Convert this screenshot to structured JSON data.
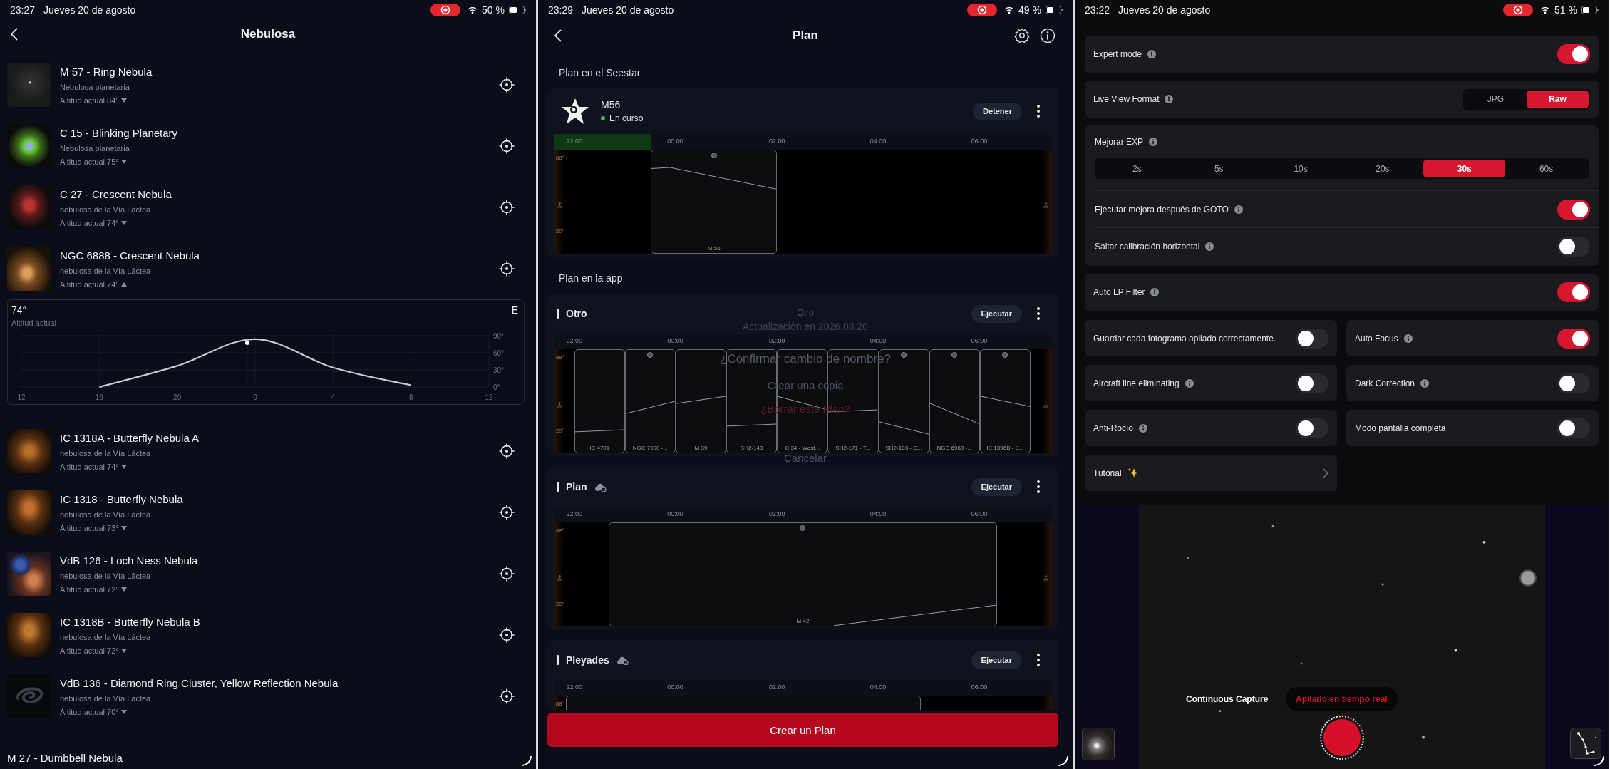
{
  "left": {
    "status_bar": {
      "time": "23:27",
      "date": "Jueves 20 de agosto",
      "battery": "50 %"
    },
    "title": "Nebulosa",
    "objects": [
      {
        "name": "M 57 - Ring Nebula",
        "type": "Nebulosa planetaria",
        "altitude": "Altitud actual 84°",
        "expanded": false,
        "kind": "photo"
      },
      {
        "name": "C 15 - Blinking Planetary",
        "type": "Nebulosa planetaria",
        "altitude": "Altitud actual 75°",
        "expanded": false,
        "kind": "photo"
      },
      {
        "name": "C 27 - Crescent Nebula",
        "type": "nebulosa de la Vía Láctea",
        "altitude": "Altitud actual 74°",
        "expanded": false,
        "kind": "photo"
      },
      {
        "name": "NGC 6888 - Crescent Nebula",
        "type": "nebulosa de la Vía Láctea",
        "altitude": "Altitud actual 74°",
        "expanded": true,
        "kind": "photo",
        "detail": {
          "altitude": "74°",
          "caption": "Altitud actual",
          "direction": "E",
          "chart_data": {
            "type": "line",
            "categories": [
              "12",
              "16",
              "20",
              "0",
              "4",
              "8",
              "12"
            ],
            "values": [
              null,
              0,
              37,
              84,
              34,
              3,
              null
            ],
            "ylim": [
              0,
              90
            ],
            "yticks": [
              {
                "value": 0,
                "label": "0°"
              },
              {
                "value": 30,
                "label": "30°"
              },
              {
                "value": 60,
                "label": "60°"
              },
              {
                "value": 90,
                "label": "90°"
              }
            ],
            "grid": true
          }
        }
      },
      {
        "name": "IC 1318A - Butterfly Nebula A",
        "type": "nebulosa de la Vía Láctea",
        "altitude": "Altitud actual 74°",
        "expanded": false,
        "kind": "photo"
      },
      {
        "name": "IC 1318 - Butterfly Nebula",
        "type": "nebulosa de la Vía Láctea",
        "altitude": "Altitud actual 73°",
        "expanded": false,
        "kind": "photo"
      },
      {
        "name": "VdB 126 - Loch Ness Nebula",
        "type": "nebulosa de la Vía Láctea",
        "altitude": "Altitud actual 72°",
        "expanded": false,
        "kind": "photo"
      },
      {
        "name": "IC 1318B - Butterfly Nebula B",
        "type": "nebulosa de la Vía Láctea",
        "altitude": "Altitud actual 72°",
        "expanded": false,
        "kind": "photo"
      },
      {
        "name": "VdB 136 - Diamond Ring Cluster, Yellow Reflection Nebula",
        "type": "nebulosa de la Vía Láctea",
        "altitude": "Altitud actual 70°",
        "expanded": false,
        "kind": "icon"
      },
      {
        "name": "M 27 - Dumbbell Nebula"
      }
    ]
  },
  "middle": {
    "status_bar": {
      "time": "23:29",
      "date": "Jueves 20 de agosto",
      "battery": "49 %"
    },
    "title": "Plan",
    "seestar_title": "Plan en el Seestar",
    "seestar_plan": {
      "target": "M56",
      "status": "En curso",
      "button": "Detener",
      "chart": {
        "times": [
          "22:00",
          "00:00",
          "02:00",
          "04:00",
          "06:00"
        ],
        "altitudes": [
          "88°",
          "20°"
        ],
        "blocks": [
          {
            "label": "M 56",
            "marker": true
          }
        ]
      }
    },
    "app_title": "Plan en la app",
    "app_plans": [
      {
        "name": "Otro",
        "cloud": false,
        "button": "Ejecutar",
        "chart": {
          "times": [
            "22:00",
            "00:00",
            "02:00",
            "04:00",
            "06:00"
          ],
          "altitudes": [
            "88°",
            "20°"
          ],
          "blocks": [
            {
              "label": "IC 4701",
              "marker": false
            },
            {
              "label": "NGC 7000 -...",
              "marker": true
            },
            {
              "label": "M 39",
              "marker": false
            },
            {
              "label": "SH2-140",
              "marker": false
            },
            {
              "label": "C 34 - West...",
              "marker": false
            },
            {
              "label": "SH2-171 - T...",
              "marker": false
            },
            {
              "label": "SH2-103 - C...",
              "marker": true
            },
            {
              "label": "NGC 6960 -...",
              "marker": true
            },
            {
              "label": "IC 1396B - E...",
              "marker": true
            }
          ]
        }
      },
      {
        "name": "Plan",
        "cloud": true,
        "button": "Ejecutar",
        "chart": {
          "times": [
            "22:00",
            "00:00",
            "02:00",
            "04:00",
            "06:00"
          ],
          "altitudes": [
            "88°",
            "20°"
          ],
          "blocks": [
            {
              "label": "M 42",
              "marker": true
            }
          ]
        }
      },
      {
        "name": "Pleyades",
        "cloud": true,
        "button": "Ejecutar",
        "chart": {
          "times": [
            "22:00",
            "00:00",
            "02:00",
            "04:00",
            "06:00"
          ],
          "altitudes": [
            "88°"
          ],
          "blocks": [
            {
              "marker": false
            }
          ]
        }
      }
    ],
    "dialog": {
      "title": "Otro",
      "subtitle": "Actualización en 2026.08.20",
      "items": [
        {
          "label": "¿Confirmar cambio de nombre?",
          "kind": "prompt"
        },
        {
          "label": "Crear una copia",
          "kind": "action"
        },
        {
          "label": "¿Borrar este Plan?",
          "kind": "destructive"
        },
        {
          "label": "Cancelar",
          "kind": "action"
        }
      ]
    },
    "create_button": "Crear un Plan"
  },
  "right": {
    "status_bar": {
      "time": "23:22",
      "date": "Jueves 20 de agosto",
      "battery": "51 %"
    },
    "settings": [
      {
        "kind": "toggle",
        "label": "Expert mode",
        "info": true,
        "on": true
      },
      {
        "kind": "segmented",
        "label": "Live View Format",
        "info": true,
        "options": [
          {
            "label": "JPG",
            "selected": false
          },
          {
            "label": "Raw",
            "selected": true
          }
        ]
      },
      {
        "kind": "group",
        "label": "Mejorar EXP",
        "info": true,
        "options": [
          {
            "label": "2s",
            "selected": false
          },
          {
            "label": "5s",
            "selected": false
          },
          {
            "label": "10s",
            "selected": false
          },
          {
            "label": "20s",
            "selected": false
          },
          {
            "label": "30s",
            "selected": true
          },
          {
            "label": "60s",
            "selected": false
          }
        ],
        "rows": [
          {
            "label": "Ejecutar mejora después de GOTO",
            "info": true,
            "on": true
          },
          {
            "label": "Saltar calibración horizontal",
            "info": true,
            "on": false
          }
        ]
      },
      {
        "kind": "toggle",
        "label": "Auto LP Filter",
        "info": true,
        "on": true
      }
    ],
    "grid": [
      {
        "kind": "toggle",
        "label": "Guardar cada fotograma apilado correctamente.",
        "info": false,
        "on": false
      },
      {
        "kind": "toggle",
        "label": "Auto Focus",
        "info": true,
        "on": true
      },
      {
        "kind": "toggle",
        "label": "Aircraft line eliminating",
        "info": true,
        "on": false
      },
      {
        "kind": "toggle",
        "label": "Dark Correction",
        "info": true,
        "on": false
      },
      {
        "kind": "toggle",
        "label": "Anti-Rocío",
        "info": true,
        "on": false
      },
      {
        "kind": "toggle",
        "label": "Modo pantalla completa",
        "info": false,
        "on": false
      },
      {
        "kind": "link",
        "label": "Tutorial"
      }
    ],
    "capture": {
      "modes": [
        {
          "label": "Continuous Capture",
          "selected": false
        },
        {
          "label": "Apilado en tiempo real",
          "selected": true
        }
      ]
    }
  }
}
